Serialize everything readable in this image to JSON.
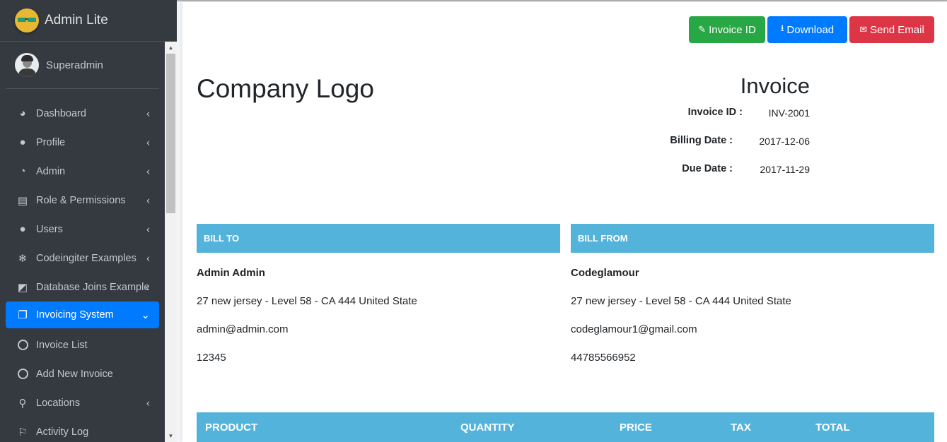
{
  "sidebar": {
    "brand": "Admin Lite",
    "user": "Superadmin",
    "items": [
      {
        "label": "Dashboard",
        "icon": "tachometer-icon",
        "glyph": "◕"
      },
      {
        "label": "Profile",
        "icon": "user-icon",
        "glyph": "●"
      },
      {
        "label": "Admin",
        "icon": "pie-chart-icon",
        "glyph": "◔"
      },
      {
        "label": "Role & Permissions",
        "icon": "book-icon",
        "glyph": "▤"
      },
      {
        "label": "Users",
        "icon": "users-icon",
        "glyph": "●"
      },
      {
        "label": "Codeingiter Examples",
        "icon": "snowflake-icon",
        "glyph": "❄"
      },
      {
        "label": "Database Joins Example",
        "icon": "external-link-icon",
        "glyph": "◩"
      },
      {
        "label": "Invoicing System",
        "icon": "copy-icon",
        "glyph": "❐"
      },
      {
        "label": "Invoice List",
        "icon": "circle-icon"
      },
      {
        "label": "Add New Invoice",
        "icon": "circle-icon"
      },
      {
        "label": "Locations",
        "icon": "map-pin-icon",
        "glyph": "⚲"
      },
      {
        "label": "Activity Log",
        "icon": "flag-icon",
        "glyph": "⚐"
      }
    ]
  },
  "toolbar": {
    "invoice_id_label": "Invoice ID",
    "download_label": "Download",
    "send_email_label": "Send Email"
  },
  "invoice": {
    "company_logo": "Company Logo",
    "title": "Invoice",
    "id_label": "Invoice ID :",
    "id_value": "INV-2001",
    "billing_date_label": "Billing Date :",
    "billing_date_value": "2017-12-06",
    "due_date_label": "Due Date :",
    "due_date_value": "2017-11-29"
  },
  "bill_to": {
    "heading": "BILL TO",
    "name": "Admin Admin",
    "address": "27 new jersey - Level 58 - CA 444 United State",
    "email": "admin@admin.com",
    "phone": "12345"
  },
  "bill_from": {
    "heading": "BILL FROM",
    "name": "Codeglamour",
    "address": "27 new jersey - Level 58 - CA 444 United State",
    "email": "codeglamour1@gmail.com",
    "phone": "44785566952"
  },
  "table": {
    "headers": [
      "PRODUCT",
      "QUANTITY",
      "PRICE",
      "TAX",
      "TOTAL"
    ]
  },
  "colors": {
    "sidebar_bg": "#343a40",
    "active_nav": "#007bff",
    "section_header": "#53b3db",
    "btn_green": "#28a745",
    "btn_blue": "#007bff",
    "btn_red": "#dc3545"
  }
}
